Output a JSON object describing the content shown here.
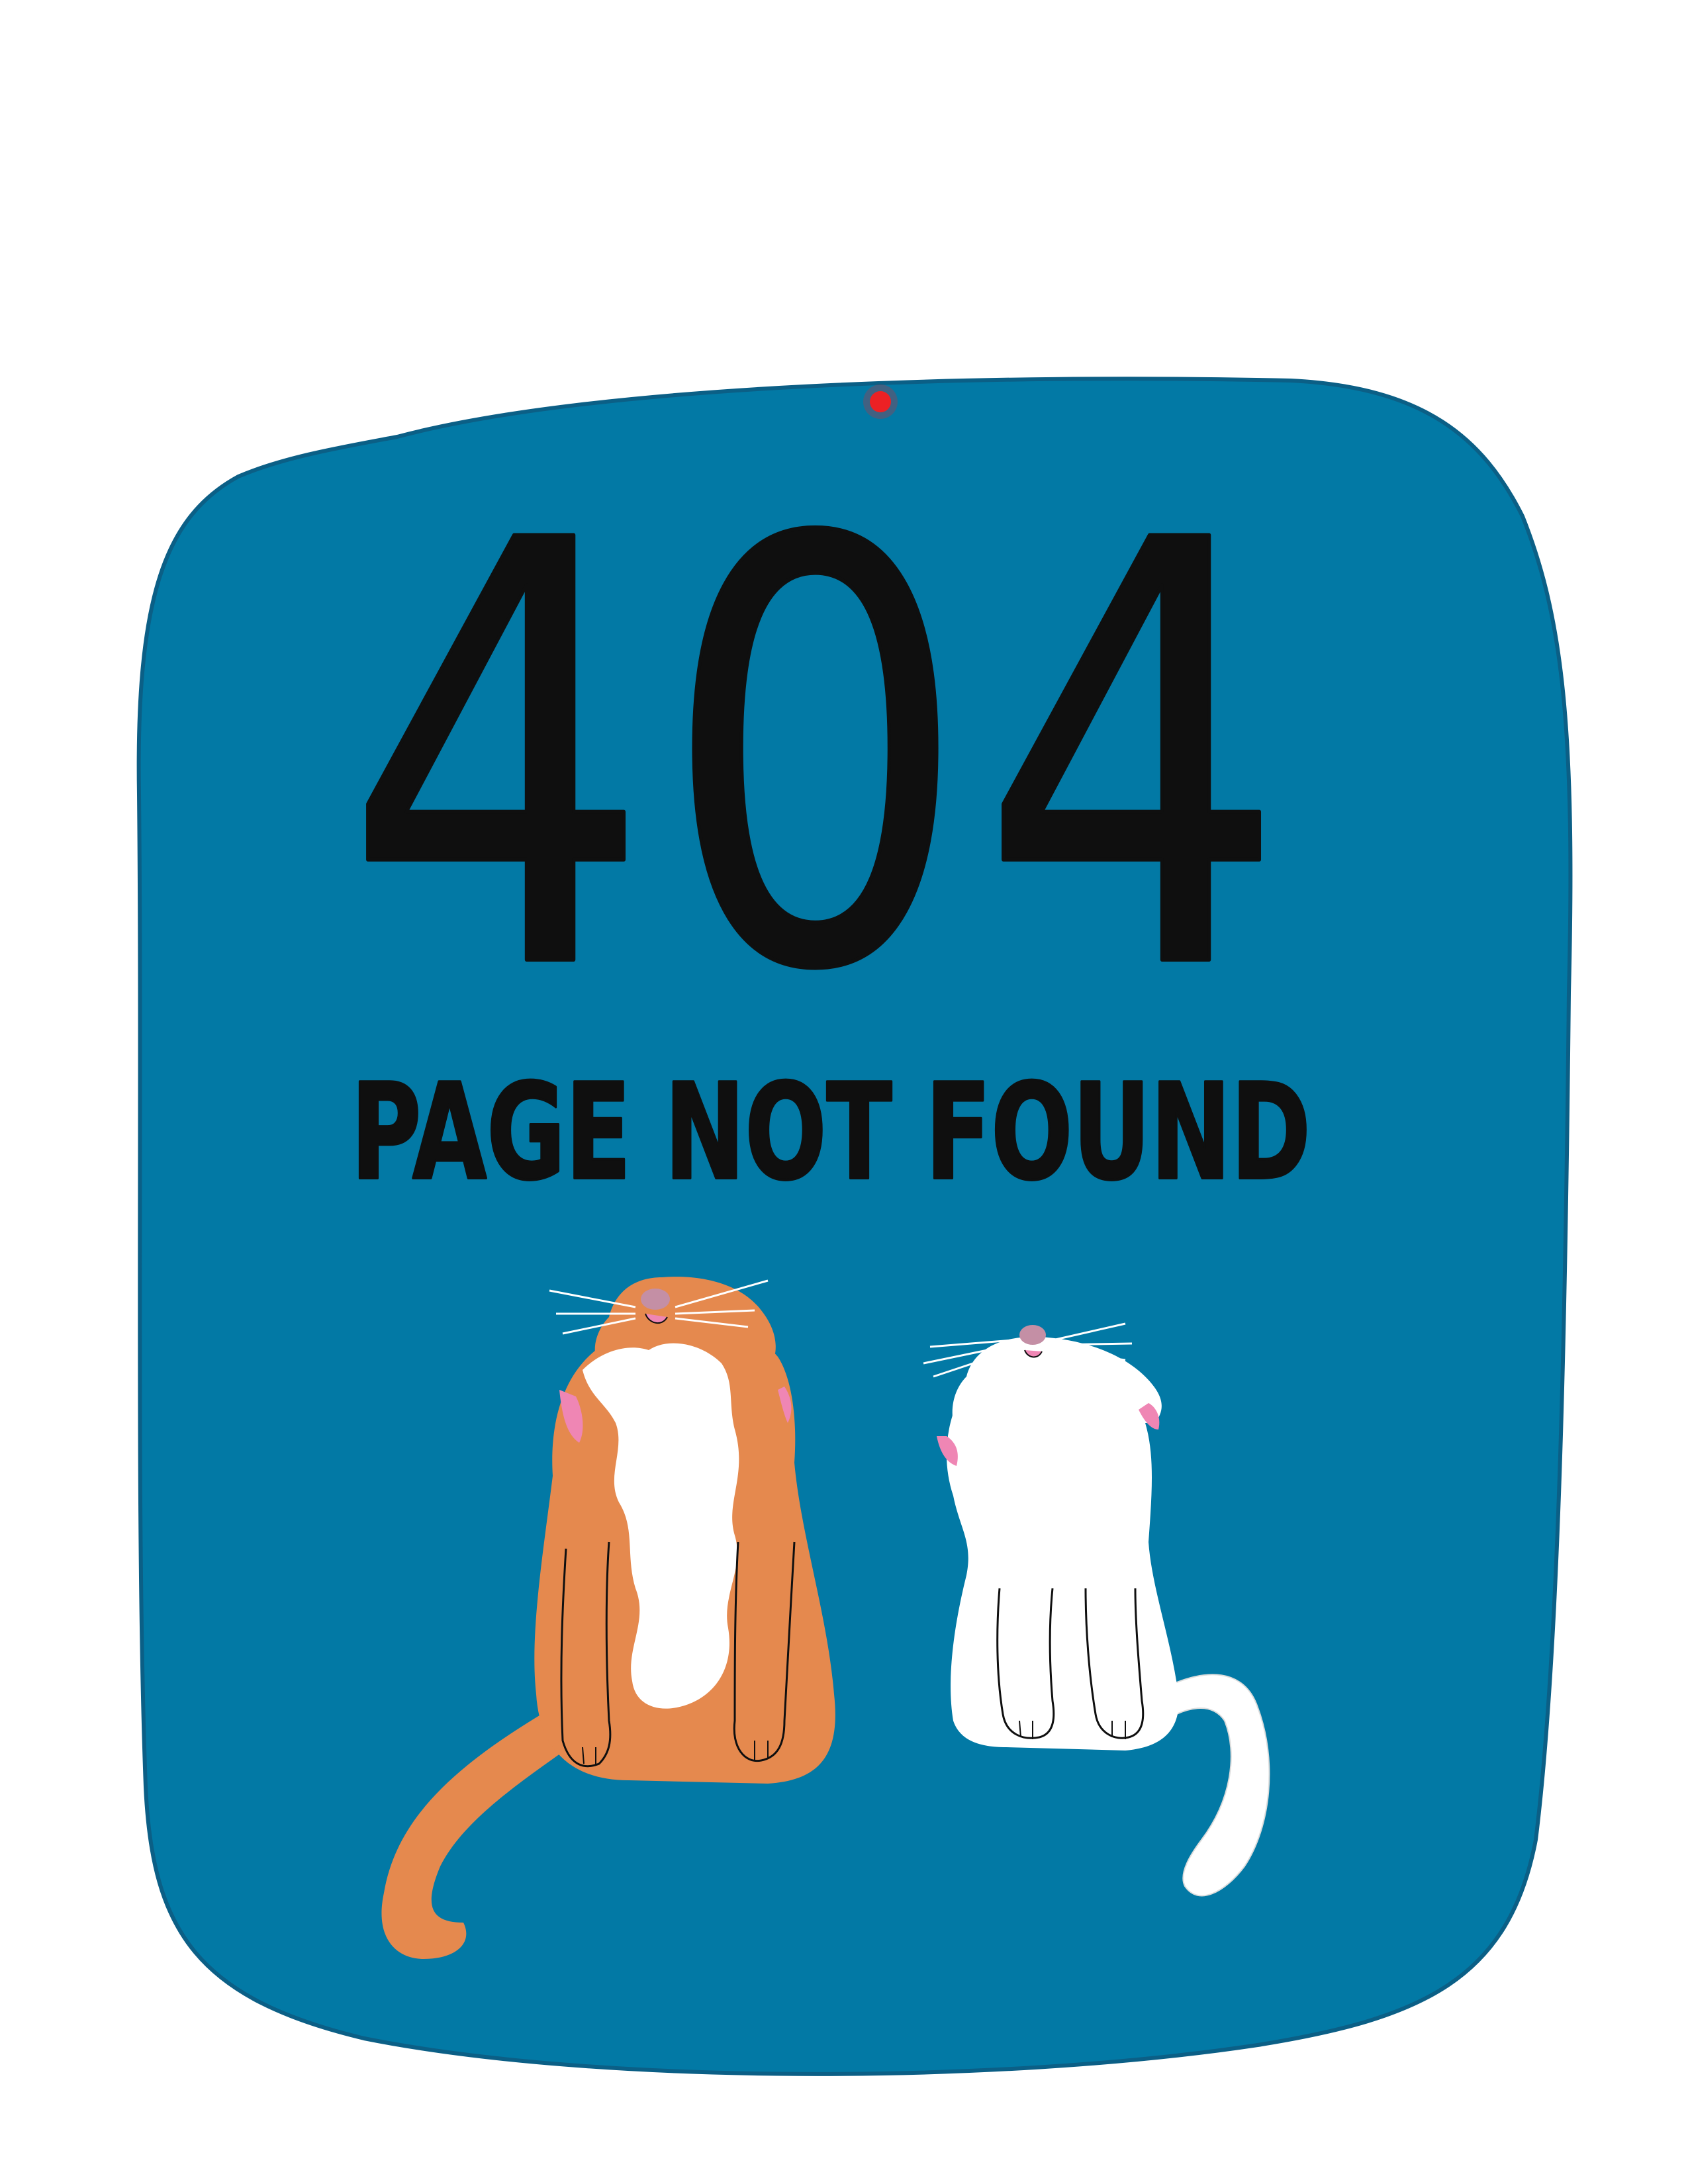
{
  "error_code": "404",
  "message": "PAGE NOT FOUND",
  "colors": {
    "page_background": "#ffffff",
    "panel": "#0279a5",
    "ink": "#0f0f0f",
    "orange_cat": "#e5894e",
    "white_cat": "#ffffff",
    "nose": "#c48fa5",
    "ear_inner": "#ef86b4",
    "laser_dot": "#ff1a1a"
  },
  "icons": {
    "laser_dot": "laser-dot-icon",
    "orange_cat": "orange-cat-illustration",
    "white_cat": "white-cat-illustration"
  }
}
